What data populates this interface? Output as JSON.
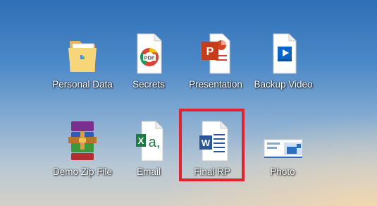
{
  "desktop": {
    "icons": [
      {
        "label": "Personal Data",
        "icon": "folder-icon"
      },
      {
        "label": "Secrets",
        "icon": "pdf-file-icon"
      },
      {
        "label": "Presentation",
        "icon": "powerpoint-file-icon"
      },
      {
        "label": "Backup Video",
        "icon": "video-file-icon"
      },
      {
        "label": "Demo Zip File",
        "icon": "winrar-archive-icon"
      },
      {
        "label": "Email",
        "icon": "excel-file-icon"
      },
      {
        "label": "Final RP",
        "icon": "word-file-icon"
      },
      {
        "label": "Photo",
        "icon": "image-file-icon"
      }
    ],
    "highlight_color": "#e0232e"
  }
}
